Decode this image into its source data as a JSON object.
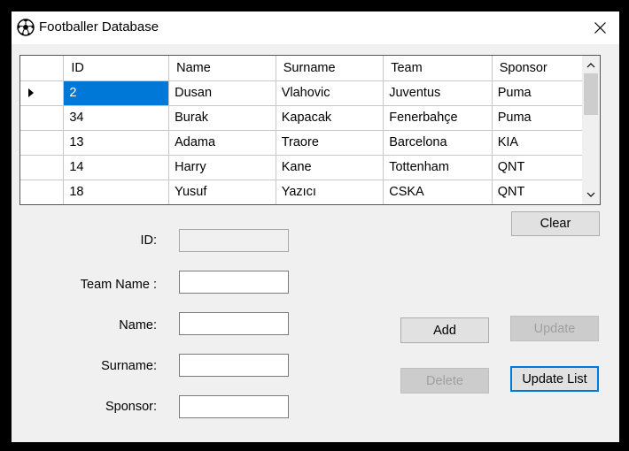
{
  "window": {
    "title": "Footballer Database",
    "app_icon": "soccer-ball-icon",
    "close_icon": "close-icon"
  },
  "grid": {
    "columns": [
      "ID",
      "Name",
      "Surname",
      "Team",
      "Sponsor"
    ],
    "rows": [
      [
        "2",
        "Dusan",
        "Vlahovic",
        "Juventus",
        "Puma"
      ],
      [
        "34",
        "Burak",
        "Kapacak",
        "Fenerbahçe",
        "Puma"
      ],
      [
        "13",
        "Adama",
        "Traore",
        "Barcelona",
        "KIA"
      ],
      [
        "14",
        "Harry",
        "Kane",
        "Tottenham",
        "QNT"
      ],
      [
        "18",
        "Yusuf",
        "Yazıcı",
        "CSKA",
        "QNT"
      ]
    ],
    "selected_row": 0,
    "selection_color": "#0078d7"
  },
  "form": {
    "id_label": "ID:",
    "team_label": "Team Name :",
    "name_label": "Name:",
    "surname_label": "Surname:",
    "sponsor_label": "Sponsor:",
    "id_value": "",
    "team_value": "",
    "name_value": "",
    "surname_value": "",
    "sponsor_value": ""
  },
  "buttons": {
    "clear": "Clear",
    "add": "Add",
    "update": "Update",
    "delete": "Delete",
    "update_list": "Update List"
  }
}
